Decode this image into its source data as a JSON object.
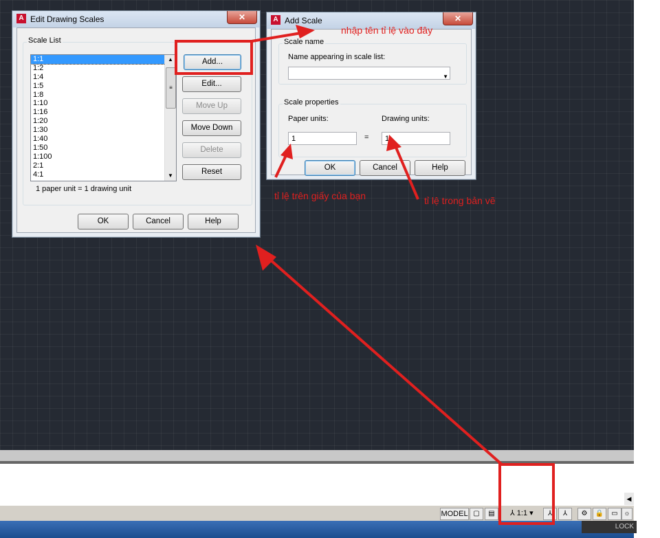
{
  "edit_dialog": {
    "title": "Edit Drawing Scales",
    "close_glyph": "✕",
    "scale_list_label": "Scale List",
    "scales": [
      "1:1",
      "1:2",
      "1:4",
      "1:5",
      "1:8",
      "1:10",
      "1:16",
      "1:20",
      "1:30",
      "1:40",
      "1:50",
      "1:100",
      "2:1",
      "4:1"
    ],
    "selected_index": 0,
    "buttons": {
      "add": "Add...",
      "edit": "Edit...",
      "move_up": "Move Up",
      "move_down": "Move Down",
      "delete": "Delete",
      "reset": "Reset"
    },
    "footer_text": "1 paper unit = 1 drawing unit",
    "ok": "OK",
    "cancel": "Cancel",
    "help": "Help"
  },
  "add_dialog": {
    "title": "Add Scale",
    "close_glyph": "✕",
    "scale_name_group": "Scale name",
    "name_label": "Name appearing in scale list:",
    "name_value": "",
    "scale_props_group": "Scale properties",
    "paper_units_label": "Paper units:",
    "paper_units_value": "1",
    "equals": "=",
    "drawing_units_label": "Drawing units:",
    "drawing_units_value": "1",
    "ok": "OK",
    "cancel": "Cancel",
    "help": "Help"
  },
  "annotations": {
    "enter_name": "nhập tên tỉ lệ vào đây",
    "paper_scale": "tỉ lệ trên giấy của bạn",
    "drawing_scale": "tỉ lệ trong bản vẽ"
  },
  "status_bar": {
    "model_label": "MODEL",
    "scale_value": "1:1",
    "lock_label": "LOCK"
  },
  "colors": {
    "annotation_red": "#e0201f",
    "canvas_bg": "#252a33",
    "selection_blue": "#3399ff"
  }
}
